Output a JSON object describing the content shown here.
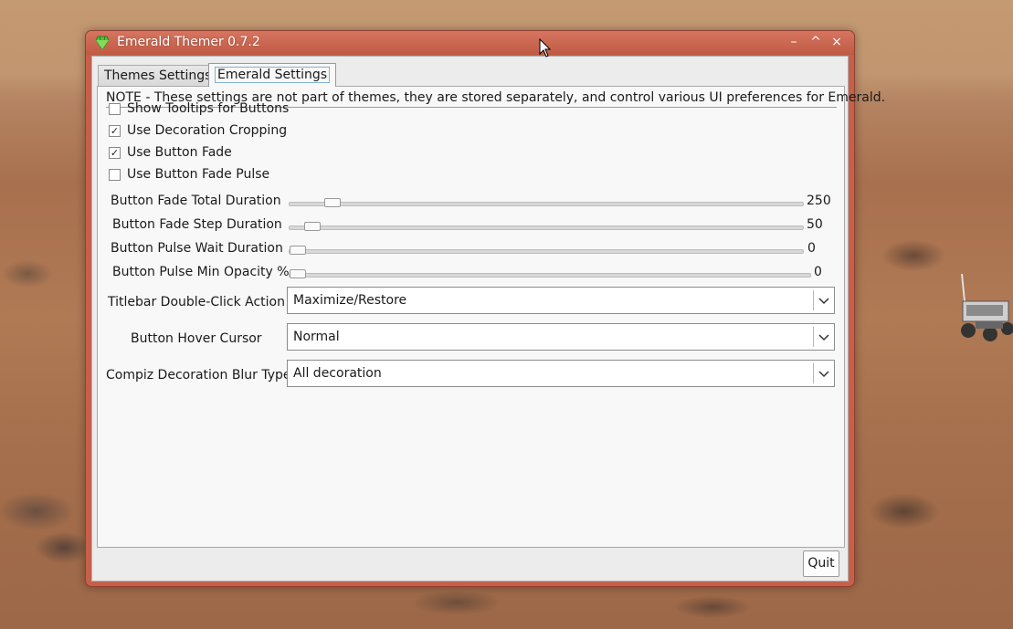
{
  "window": {
    "title": "Emerald Themer 0.7.2",
    "controls": {
      "minimize": "–",
      "maximize": "^",
      "close": "×"
    }
  },
  "tabs": [
    {
      "label": "Themes Settings",
      "active": false
    },
    {
      "label": "Emerald Settings",
      "active": true
    }
  ],
  "note": "NOTE - These settings are not part of themes, they are stored separately, and control various UI preferences for Emerald.",
  "checkboxes": [
    {
      "label": "Show Tooltips for Buttons",
      "checked": false
    },
    {
      "label": "Use Decoration Cropping",
      "checked": true
    },
    {
      "label": "Use Button Fade",
      "checked": true
    },
    {
      "label": "Use Button Fade Pulse",
      "checked": false
    }
  ],
  "sliders": [
    {
      "label": "Button Fade Total Duration",
      "value": "250",
      "fraction": 0.07
    },
    {
      "label": "Button Fade Step Duration",
      "value": "50",
      "fraction": 0.03
    },
    {
      "label": "Button Pulse Wait Duration",
      "value": "0",
      "fraction": 0.0
    },
    {
      "label": "Button Pulse Min Opacity %",
      "value": "0",
      "fraction": 0.0
    }
  ],
  "combos": [
    {
      "label": "Titlebar Double-Click Action",
      "value": "Maximize/Restore"
    },
    {
      "label": "Button Hover Cursor",
      "value": "Normal"
    },
    {
      "label": "Compiz Decoration Blur Type",
      "value": "All decoration"
    }
  ],
  "quit_label": "Quit",
  "colors": {
    "titlebar": "#c6604a",
    "panel": "#f8f8f8",
    "emerald_icon": "#4fc23a"
  }
}
